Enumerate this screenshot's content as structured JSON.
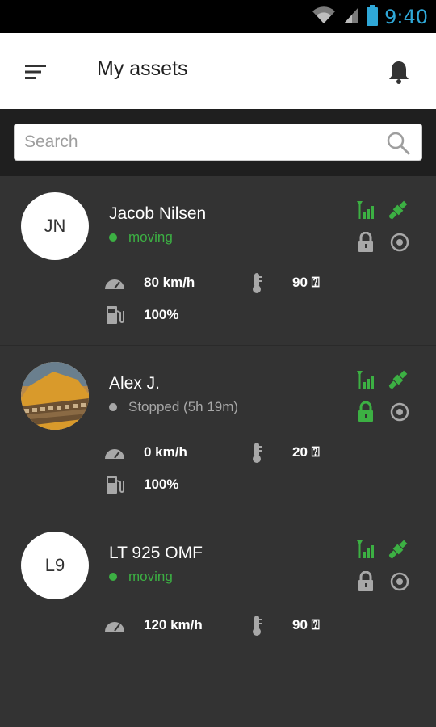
{
  "status_bar": {
    "time": "9:40"
  },
  "app_bar": {
    "title": "My assets"
  },
  "search": {
    "placeholder": "Search",
    "value": ""
  },
  "colors": {
    "accent_green": "#3cb043",
    "status_blue": "#2fa8d8",
    "muted_gray": "#a8a8a8"
  },
  "assets": [
    {
      "initials": "JN",
      "name": "Jacob Nilsen",
      "status": "moving",
      "speed": "80 km/h",
      "temperature": "90 ⍰",
      "fuel": "100%",
      "lock_active": false
    },
    {
      "initials": "",
      "name": "Alex J.",
      "status": "Stopped (5h 19m)",
      "speed": "0 km/h",
      "temperature": "20 ⍰",
      "fuel": "100%",
      "lock_active": true,
      "avatar_photo": true
    },
    {
      "initials": "L9",
      "name": "LT 925 OMF",
      "status": "moving",
      "speed": "120 km/h",
      "temperature": "90 ⍰",
      "lock_active": false
    }
  ]
}
